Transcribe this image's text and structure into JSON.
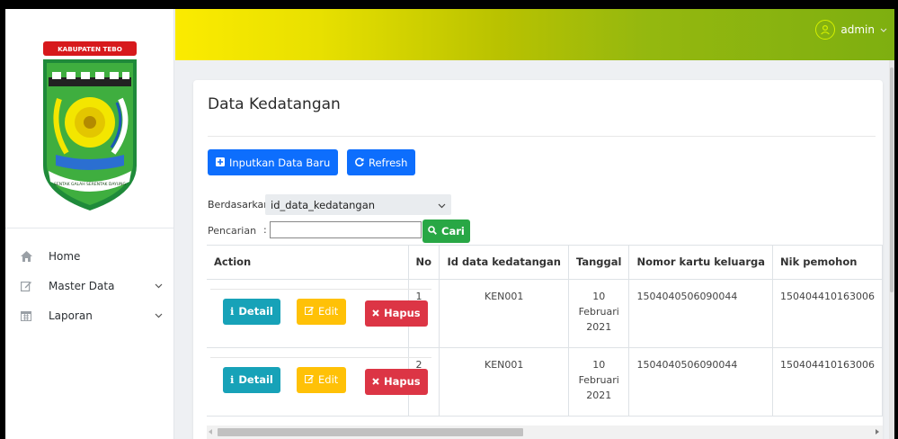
{
  "sidebar": {
    "logo_top_text": "KABUPATEN TEBO",
    "logo_motto": "SENTAK GALAH SERENTAK ...",
    "items": [
      {
        "label": "Home",
        "icon": "home-icon"
      },
      {
        "label": "Master Data",
        "icon": "edit-icon"
      },
      {
        "label": "Laporan",
        "icon": "calendar-icon"
      }
    ]
  },
  "header": {
    "user_name": "admin"
  },
  "main": {
    "title": "Data Kedatangan",
    "btn_new": "Inputkan Data Baru",
    "btn_refresh": "Refresh",
    "filter_label": "Berdasarkan:",
    "filter_value": "id_data_kedatangan",
    "search_label": "Pencarian",
    "search_colon": ":",
    "search_value": "",
    "search_button": "Cari"
  },
  "table": {
    "columns": [
      "Action",
      "No",
      "Id data kedatangan",
      "Tanggal",
      "Nomor kartu keluarga",
      "Nik pemohon"
    ],
    "action_labels": {
      "detail": "Detail",
      "edit": "Edit",
      "delete": "Hapus"
    },
    "rows": [
      {
        "no": "1",
        "id": "KEN001",
        "tanggal_day": "10",
        "tanggal_month": "Februari",
        "tanggal_year": "2021",
        "kk": "1504040506090044",
        "nik": "150404410163006"
      },
      {
        "no": "2",
        "id": "KEN001",
        "tanggal_day": "10",
        "tanggal_month": "Februari",
        "tanggal_year": "2021",
        "kk": "1504040506090044",
        "nik": "150404410163006"
      }
    ]
  },
  "colors": {
    "primary": "#0d6efd",
    "info": "#17a2b8",
    "warning": "#ffc107",
    "danger": "#dc3545",
    "success": "#28a745"
  }
}
